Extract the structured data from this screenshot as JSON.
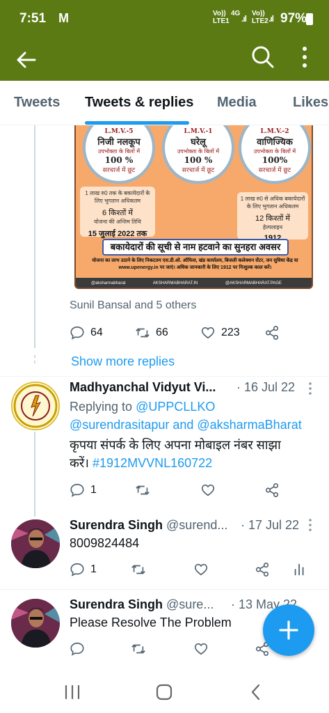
{
  "status": {
    "time": "7:51",
    "mail_icon": "M",
    "net1": [
      "Vo))",
      "LTE1"
    ],
    "net1_badge": "4G",
    "net2": [
      "Vo))",
      "LTE2"
    ],
    "battery": "97%"
  },
  "appbar": {
    "back_icon": "arrow-left-icon",
    "search_icon": "search-icon",
    "more_icon": "more-vert-icon"
  },
  "tabs": [
    {
      "label": "Tweets",
      "active": false
    },
    {
      "label": "Tweets & replies",
      "active": true
    },
    {
      "label": "Media",
      "active": false
    },
    {
      "label": "Likes",
      "active": false
    }
  ],
  "poster": {
    "circles": [
      {
        "code": "L.M.V.-5",
        "title": "निजी नलकूप",
        "sub": "उपभोक्ता के बिलों में",
        "pct": "100 %",
        "tail": "सरचार्ज में छूट"
      },
      {
        "code": "L.M.V.-1",
        "title": "घरेलू",
        "sub": "उपभोक्ता के बिलों में",
        "pct": "100 %",
        "tail": "सरचार्ज में छूट"
      },
      {
        "code": "L.M.V.-2",
        "title": "वाणिज्यिक",
        "sub": "उपभोक्ता के बिलों में",
        "pct": "100%",
        "tail": "सरचार्ज में छूट"
      }
    ],
    "box_left": {
      "line": "1 लाख रु0 तक के बकायेदारों के लिए भुगतान अधिकतम",
      "big": "6 किश्तों में",
      "note": "योजना की अन्तिम तिथि",
      "date": "15 जुलाई 2022 तक"
    },
    "box_right": {
      "line": "1 लाख रु0 से अधिक बकायेदारों के लिए भुगतान अधिकतम",
      "big": "12 किश्तों में",
      "note": "हेल्पलाइन",
      "date": "1912"
    },
    "banner": "बकायेदारों की सूची से नाम हटवाने का सुनहरा अवसर",
    "info": "योजना का लाभ उठाने के लिए निकटतम एस.डी.ओ. ऑफिस, खंड कार्यालय, बिजली कलेक्शन सेंटर, जन सुविधा केंद्र या www.upenergy.in पर जाएं। अधिक जानकारी के लिए 1912 पर निःशुल्क काल करें।",
    "footer": [
      "@aksharmabharat",
      "AKSHARMABHARAT.IN",
      "@AKSHARMABHARAT.PAGE"
    ]
  },
  "tweet1": {
    "liked_by": "Sunil Bansal and 5 others",
    "replies": "64",
    "retweets": "66",
    "likes": "223"
  },
  "show_more": "Show more replies",
  "reply1": {
    "name": "Madhyanchal Vidyut Vi...",
    "date": "· 16 Jul 22",
    "replying_prefix": "Replying to ",
    "replying_line1": "@UPPCLLKO",
    "replying_line2": "@surendrasitapur and @aksharmaBharat",
    "text_line1": "कृपया संपर्क के लिए अपना मोबाइल नंबर साझा",
    "text_line2_plain": "करें। ",
    "text_line2_tag": "#1912MVVNL160722",
    "replies": "1"
  },
  "reply2": {
    "name": "Surendra Singh",
    "handle": "@surend...",
    "date": "· 17 Jul 22",
    "text": "8009824484",
    "replies": "1"
  },
  "reply3": {
    "name": "Surendra Singh",
    "handle": "@sure...",
    "date": "· 13 May 22",
    "text": "Please Resolve The Problem"
  },
  "fab_icon": "plus-icon",
  "navbar": [
    "recent-apps-icon",
    "home-icon",
    "back-icon"
  ]
}
